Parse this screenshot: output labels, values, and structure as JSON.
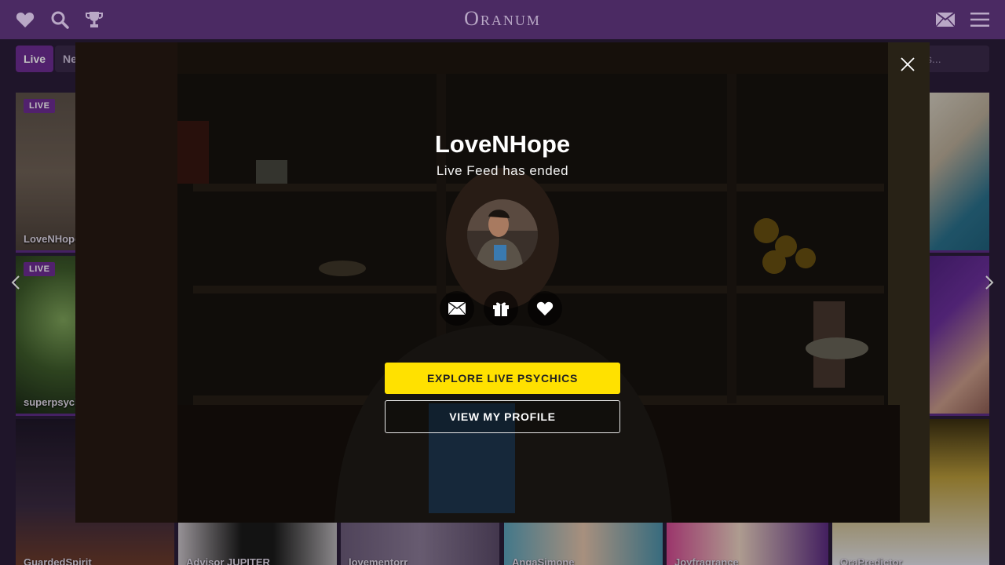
{
  "header": {
    "logo": "Oranum"
  },
  "filters": {
    "live_label": "Live",
    "new_label": "Ne",
    "search_placeholder": "s..."
  },
  "grid": {
    "badge_label": "LIVE",
    "tiles_left": [
      {
        "name": "LoveNHope",
        "live": true
      },
      {
        "name": "superpsych",
        "live": true
      },
      {
        "name": "GuardedSpirit",
        "live": false
      }
    ],
    "tiles_bottom": [
      {
        "name": "Advisor JUPITER"
      },
      {
        "name": "lovementorr"
      },
      {
        "name": "AngaSimone"
      },
      {
        "name": "Joyfragrance"
      },
      {
        "name": "OraPredictor"
      }
    ]
  },
  "modal": {
    "title": "LoveNHope",
    "subtitle": "Live Feed has ended",
    "explore_button": "EXPLORE LIVE PSYCHICS",
    "profile_button": "VIEW MY PROFILE",
    "actions": [
      "mail-icon",
      "gift-icon",
      "heart-icon"
    ]
  },
  "colors": {
    "header_bg": "#4b2a63",
    "accent_purple": "#6d2c92",
    "cta_yellow": "#ffe100"
  }
}
